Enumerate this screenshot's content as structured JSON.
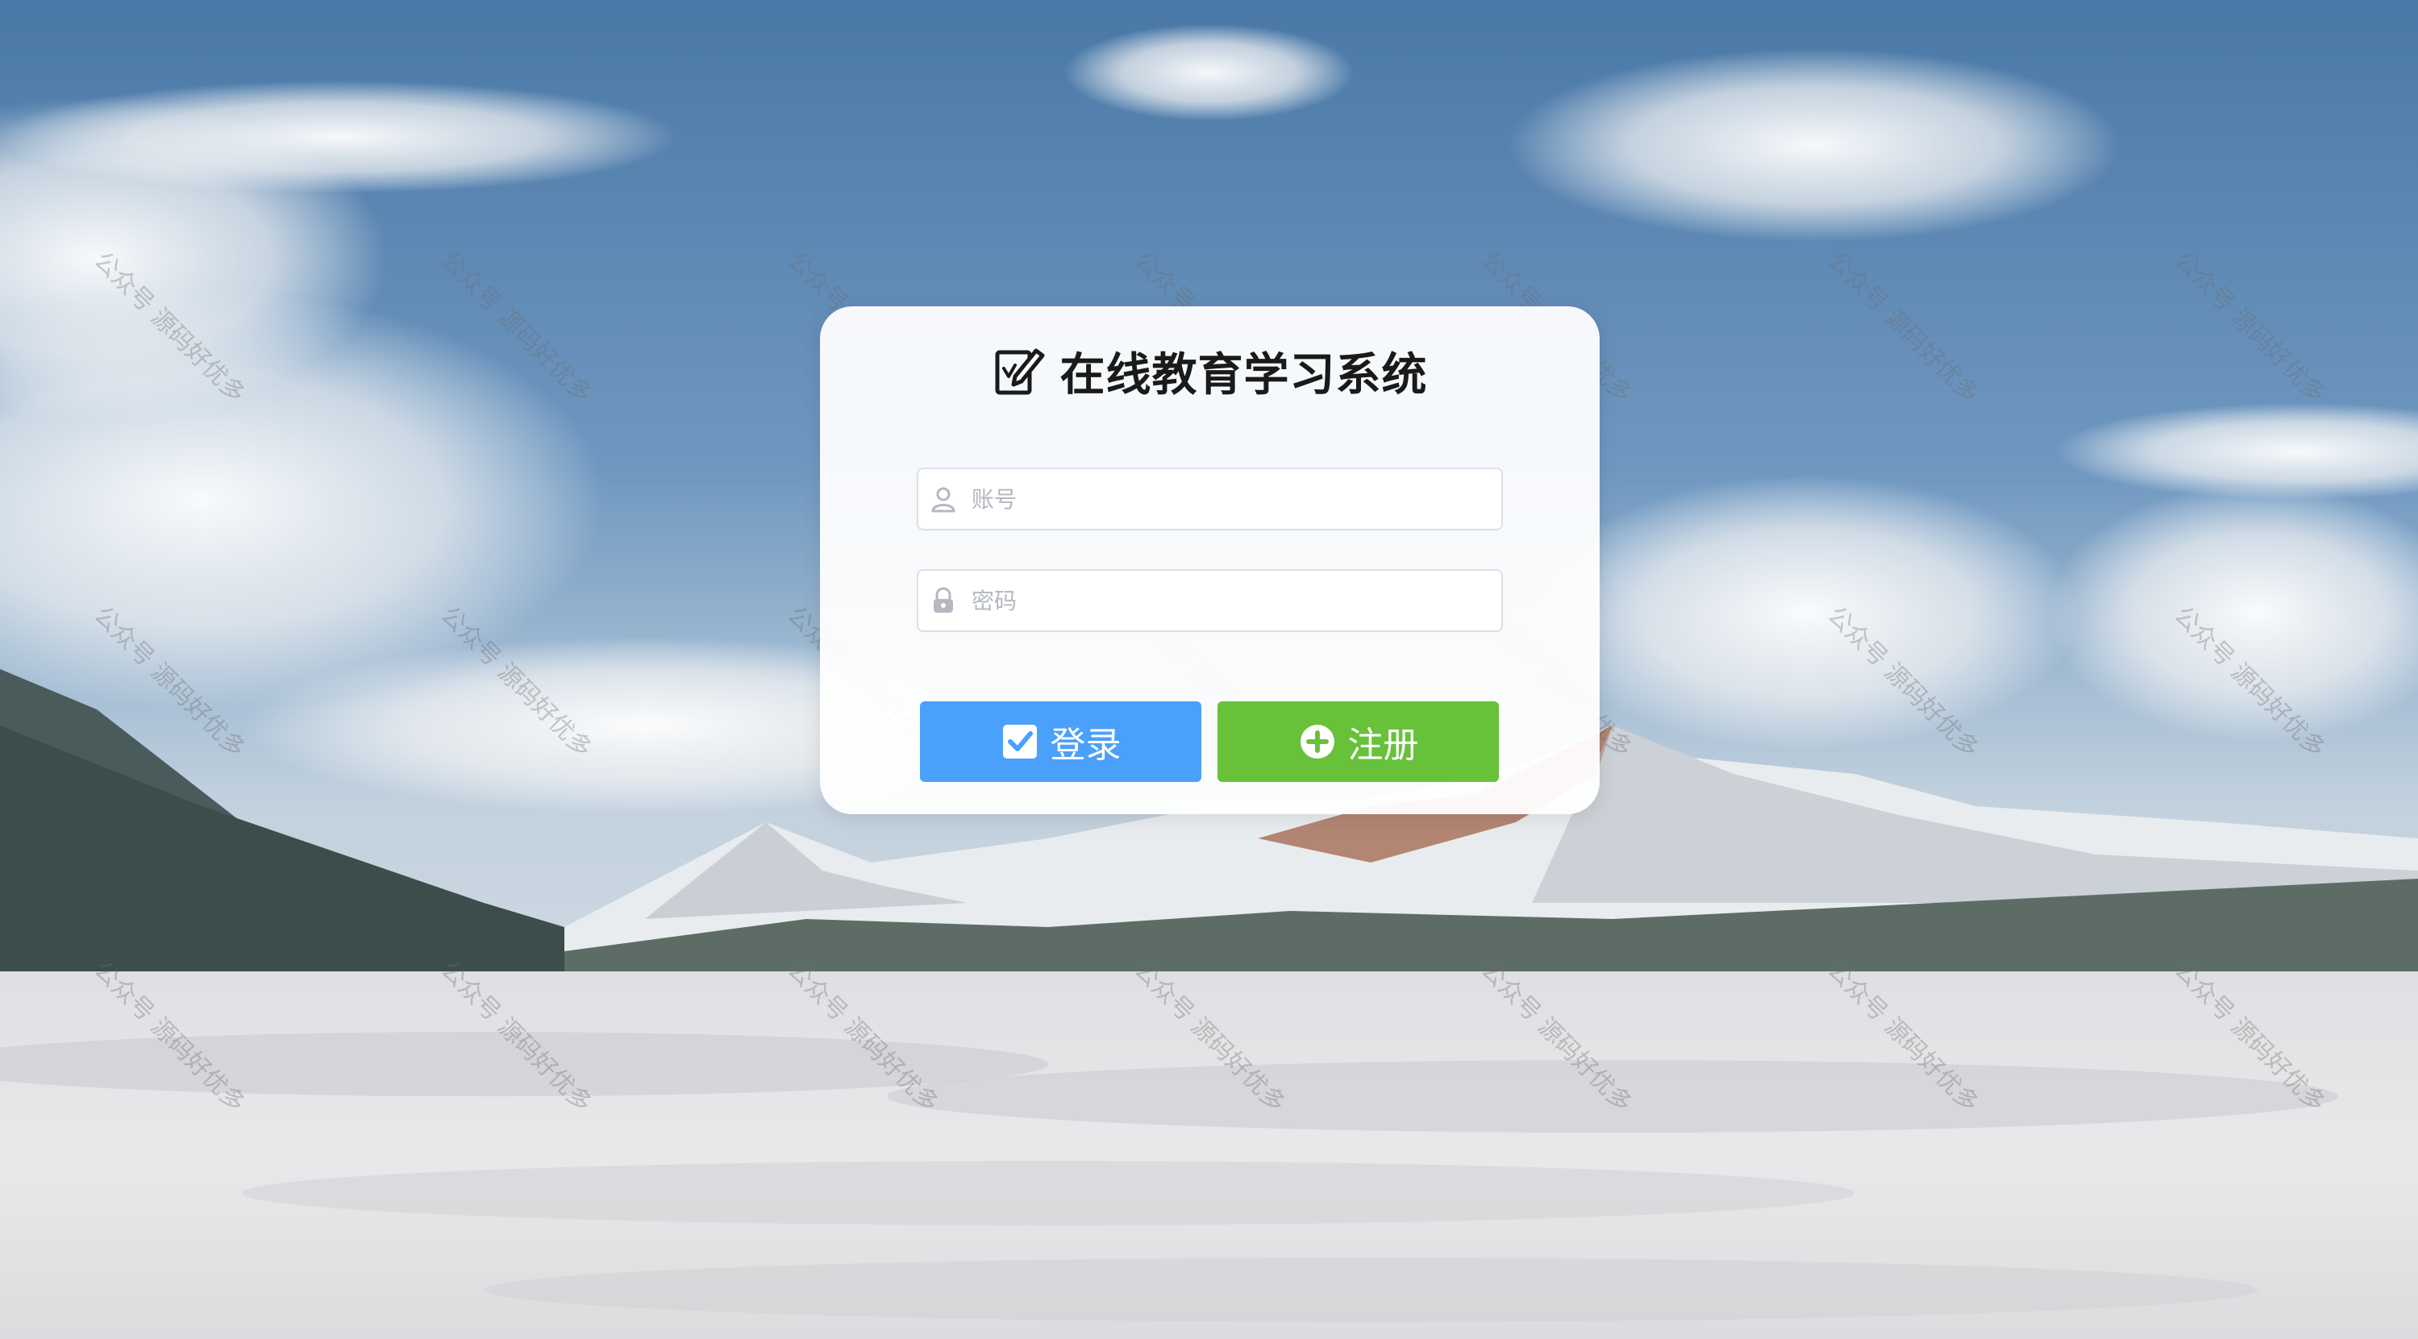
{
  "app": {
    "title": "在线教育学习系统"
  },
  "form": {
    "account_placeholder": "账号",
    "password_placeholder": "密码",
    "login_label": "登录",
    "register_label": "注册"
  },
  "watermark": {
    "text": "公众号 源码好优多"
  },
  "colors": {
    "login_button": "#4ba0fb",
    "register_button": "#67c23a",
    "card_background": "#ffffff",
    "title_text": "#1a1a1a"
  },
  "icons": {
    "title": "edit-note-icon",
    "account": "user-icon",
    "password": "lock-icon",
    "login": "check-square-icon",
    "register": "plus-circle-icon"
  }
}
